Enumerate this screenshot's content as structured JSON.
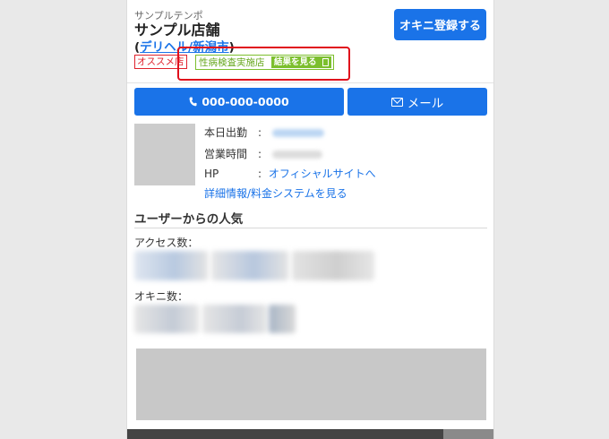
{
  "shop": {
    "sub_name": "サンプルテンポ",
    "name": "サンプル店舗",
    "category_open": "(",
    "category_link": "デリヘル/新潟市",
    "category_close": ")",
    "tag_recommend": "オススメ店",
    "tag_inspection": "性病検査実施店",
    "tag_result_button": "結果を見る"
  },
  "actions": {
    "register_label": "オキニ登録する",
    "tel_label": "000-000-0000",
    "mail_label": "メール"
  },
  "info": {
    "today_label": "本日出勤",
    "hours_label": "営業時間",
    "hp_label": "HP",
    "separator": ":",
    "hp_link": "オフィシャルサイトへ",
    "detail_link": "詳細情報/料金システムを見る"
  },
  "popularity": {
    "title": "ユーザーからの人気",
    "access_label": "アクセス数：",
    "okini_label": "オキニ数："
  },
  "colors": {
    "accent": "#1a73e8",
    "recommend": "#e0222d",
    "inspection": "#7cbf2e",
    "highlight": "#e00d1b"
  }
}
